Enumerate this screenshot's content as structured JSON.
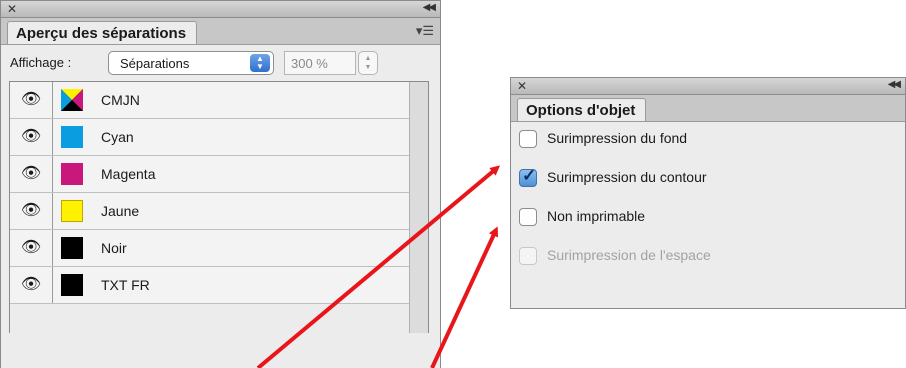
{
  "separations_panel": {
    "title": "Aperçu des séparations",
    "affichage_label": "Affichage :",
    "affichage_value": "Séparations",
    "zoom_value": "300 %",
    "inks": [
      {
        "name": "CMJN",
        "icon": "cmyk-swatch-icon",
        "color": "multi"
      },
      {
        "name": "Cyan",
        "icon": "cyan-swatch-icon",
        "color": "#0a9ee0"
      },
      {
        "name": "Magenta",
        "icon": "magenta-swatch-icon",
        "color": "#c8187c"
      },
      {
        "name": "Jaune",
        "icon": "yellow-swatch-icon",
        "color": "#fff200"
      },
      {
        "name": "Noir",
        "icon": "black-swatch-icon",
        "color": "#000000"
      },
      {
        "name": "TXT FR",
        "icon": "black-swatch-icon",
        "color": "#000000"
      }
    ]
  },
  "options_panel": {
    "title": "Options d'objet",
    "options": [
      {
        "label": "Surimpression du fond",
        "checked": false,
        "enabled": true
      },
      {
        "label": "Surimpression du contour",
        "checked": true,
        "enabled": true
      },
      {
        "label": "Non imprimable",
        "checked": false,
        "enabled": true
      },
      {
        "label": "Surimpression de l'espace",
        "checked": false,
        "enabled": false
      }
    ]
  },
  "colors": {
    "arrow": "#e8151b",
    "accent": "#4d8fd8"
  }
}
